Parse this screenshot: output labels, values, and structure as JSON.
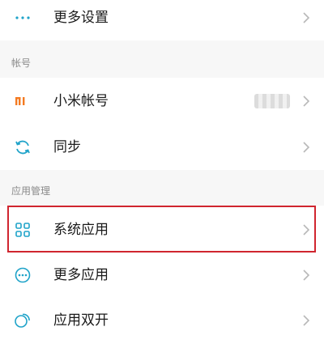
{
  "settings": {
    "more_settings": {
      "label": "更多设置",
      "icon": "dots-icon"
    },
    "account_section": {
      "title": "帐号",
      "items": [
        {
          "label": "小米帐号",
          "icon": "mi-logo-icon"
        },
        {
          "label": "同步",
          "icon": "sync-icon"
        }
      ]
    },
    "apps_section": {
      "title": "应用管理",
      "items": [
        {
          "label": "系统应用",
          "icon": "grid-icon"
        },
        {
          "label": "更多应用",
          "icon": "more-apps-icon"
        },
        {
          "label": "应用双开",
          "icon": "dual-apps-icon"
        }
      ]
    }
  },
  "colors": {
    "accent": "#1fa3c9",
    "highlight": "#d0252f",
    "mi_orange": "#f47a21"
  }
}
